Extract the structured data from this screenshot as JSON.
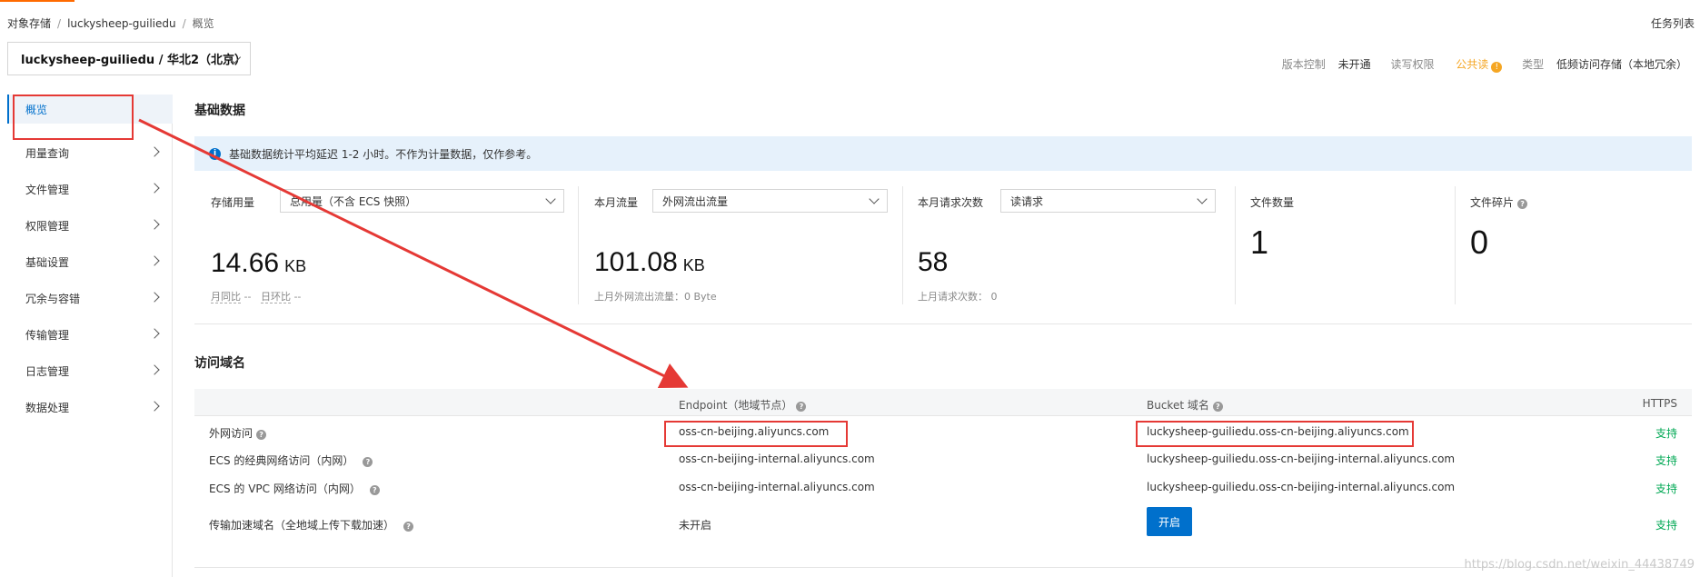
{
  "breadcrumb": [
    "对象存储",
    "luckysheep-guiliedu",
    "概览"
  ],
  "task_list_label": "任务列表",
  "bucket_selector": {
    "value": "luckysheep-guiliedu / 华北2（北京）"
  },
  "bucket_meta": {
    "version_label": "版本控制",
    "version_value": "未开通",
    "acl_label": "读写权限",
    "acl_value": "公共读",
    "type_label": "类型",
    "type_value": "低频访问存储（本地冗余）"
  },
  "sidebar": {
    "items": [
      {
        "label": "概览",
        "active": true
      },
      {
        "label": "用量查询"
      },
      {
        "label": "文件管理"
      },
      {
        "label": "权限管理"
      },
      {
        "label": "基础设置"
      },
      {
        "label": "冗余与容错"
      },
      {
        "label": "传输管理"
      },
      {
        "label": "日志管理"
      },
      {
        "label": "数据处理"
      }
    ]
  },
  "basic_data": {
    "title": "基础数据",
    "notice": "基础数据统计平均延迟 1-2 小时。不作为计量数据，仅作参考。",
    "storage": {
      "label": "存储用量",
      "select": "总用量（不含 ECS 快照）",
      "value": "14.66",
      "unit": "KB",
      "mom_label": "月同比",
      "mom_value": "--",
      "dod_label": "日环比",
      "dod_value": "--"
    },
    "traffic": {
      "label": "本月流量",
      "select": "外网流出流量",
      "value": "101.08",
      "unit": "KB",
      "sub": "上月外网流出流量：0 Byte"
    },
    "requests": {
      "label": "本月请求次数",
      "select": "读请求",
      "value": "58",
      "sub": "上月请求次数：  0"
    },
    "files": {
      "label": "文件数量",
      "value": "1"
    },
    "fragments": {
      "label": "文件碎片",
      "value": "0"
    }
  },
  "access_domain": {
    "title": "访问域名",
    "headers": {
      "endpoint": "Endpoint（地域节点）",
      "bucket_domain": "Bucket 域名",
      "https": "HTTPS"
    },
    "rows": [
      {
        "name": "外网访问",
        "endpoint": "oss-cn-beijing.aliyuncs.com",
        "bucket": "luckysheep-guiliedu.oss-cn-beijing.aliyuncs.com",
        "https": "支持"
      },
      {
        "name": "ECS 的经典网络访问（内网）",
        "endpoint": "oss-cn-beijing-internal.aliyuncs.com",
        "bucket": "luckysheep-guiliedu.oss-cn-beijing-internal.aliyuncs.com",
        "https": "支持"
      },
      {
        "name": "ECS 的 VPC 网络访问（内网）",
        "endpoint": "oss-cn-beijing-internal.aliyuncs.com",
        "bucket": "luckysheep-guiliedu.oss-cn-beijing-internal.aliyuncs.com",
        "https": "支持"
      },
      {
        "name": "传输加速域名（全地域上传下载加速）",
        "endpoint": "未开启",
        "button": "开启",
        "https": "支持"
      }
    ]
  },
  "watermark": "https://blog.csdn.net/weixin_44438749",
  "colors": {
    "accent": "#0070cc",
    "annotation": "#e53935",
    "support": "#00a854",
    "warning": "#f5a623"
  }
}
